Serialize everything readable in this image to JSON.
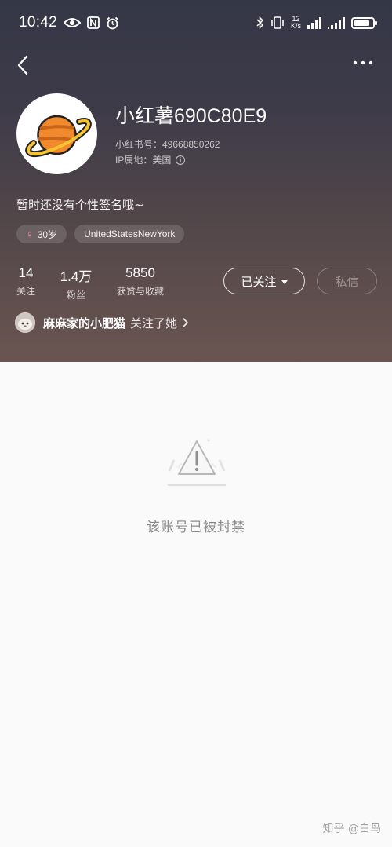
{
  "status_bar": {
    "time": "10:42",
    "network_speed_value": "12",
    "network_speed_unit": "K/s",
    "battery_level": 0.85
  },
  "profile": {
    "nickname": "小红薯690C80E9",
    "account_id": "小红书号：49668850262",
    "ip_label": "IP属地：美国",
    "bio": "暂时还没有个性签名哦~",
    "tags": [
      {
        "icon": "female-icon",
        "label": "30岁"
      },
      {
        "label": "UnitedStatesNewYork"
      }
    ],
    "stats": [
      {
        "value": "14",
        "label": "关注"
      },
      {
        "value": "1.4万",
        "label": "粉丝"
      },
      {
        "value": "5850",
        "label": "获赞与收藏"
      }
    ],
    "follow_button": "已关注",
    "message_button": "私信",
    "mutual": {
      "name": "麻麻家的小肥猫",
      "text": "关注了她"
    }
  },
  "content": {
    "banned_message": "该账号已被封禁"
  },
  "watermark": "知乎 @白鸟",
  "colors": {
    "header_top": "#343746",
    "header_bottom": "#6a5551",
    "background": "#fbfafa",
    "planet_orange": "#f08a2c",
    "ring_yellow": "#f6c431"
  }
}
